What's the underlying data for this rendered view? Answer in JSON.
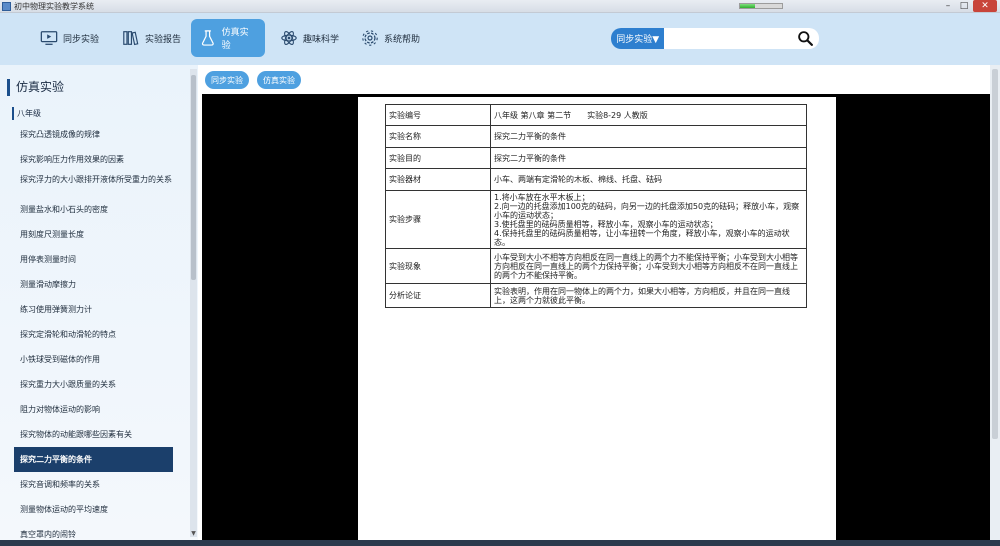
{
  "window": {
    "title": "初中物理实验教学系统",
    "progress_fraction": 0.35,
    "min_label": "–",
    "max_label": "□",
    "close_label": "✕"
  },
  "nav": {
    "items": [
      {
        "label": "同步实验",
        "icon": "monitor-play-icon"
      },
      {
        "label": "实验报告",
        "icon": "books-icon"
      },
      {
        "label": "仿真实验",
        "icon": "flask-icon",
        "active": true
      },
      {
        "label": "趣味科学",
        "icon": "atom-icon"
      },
      {
        "label": "系统帮助",
        "icon": "gear-icon"
      }
    ]
  },
  "search": {
    "scope_label": "同步实验▼",
    "value": "",
    "placeholder": "",
    "icon": "search-icon"
  },
  "sidebar": {
    "heading": "仿真实验",
    "grade": "八年级",
    "items": [
      "探究凸透镜成像的规律",
      "探究影响压力作用效果的因素",
      "探究浮力的大小跟排开液体所受重力的关系",
      "测量盐水和小石头的密度",
      "用刻度尺测量长度",
      "用停表测量时间",
      "测量滑动摩擦力",
      "练习使用弹簧测力计",
      "探究定滑轮和动滑轮的特点",
      "小铁球受到磁体的作用",
      "探究重力大小跟质量的关系",
      "阻力对物体运动的影响",
      "探究物体的动能跟哪些因素有关",
      "探究二力平衡的条件",
      "探究音调和频率的关系",
      "测量物体运动的平均速度",
      "真空罩内的闹铃"
    ],
    "selected_index": 13
  },
  "tabs": [
    "同步实验",
    "仿真实验"
  ],
  "report": {
    "rows": [
      {
        "key": "实验编号",
        "value": "八年级 第八章 第二节　　实验8-29 人教版"
      },
      {
        "key": "实验名称",
        "value": "探究二力平衡的条件"
      },
      {
        "key": "实验目的",
        "value": "探究二力平衡的条件"
      },
      {
        "key": "实验器材",
        "value": "小车、两端有定滑轮的木板、棉线、托盘、砝码"
      },
      {
        "key": "实验步骤",
        "value": "1.将小车放在水平木板上；\n2.向一边的托盘添加100克的砝码，向另一边的托盘添加50克的砝码；释放小车，观察小车的运动状态；\n3.使托盘里的砝码质量相等，释放小车，观察小车的运动状态；\n4.保持托盘里的砝码质量相等，让小车扭转一个角度，释放小车，观察小车的运动状态。"
      },
      {
        "key": "实验现象",
        "value": "小车受到大小不相等方向相反在同一直线上的两个力不能保持平衡；小车受到大小相等方向相反在同一直线上的两个力保持平衡；小车受到大小相等方向相反不在同一直线上的两个力不能保持平衡。"
      },
      {
        "key": "分析论证",
        "value": "实验表明，作用在同一物体上的两个力，如果大小相等，方向相反，并且在同一直线上，这两个力就彼此平衡。"
      }
    ]
  }
}
